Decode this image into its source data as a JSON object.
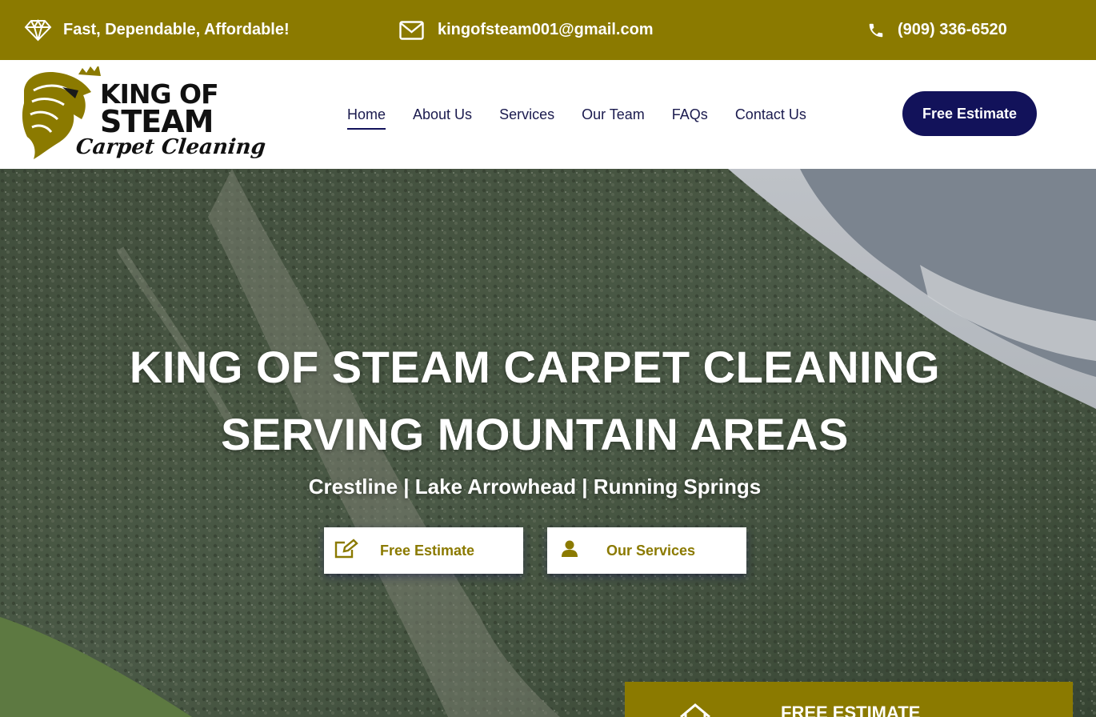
{
  "topbar": {
    "tagline": "Fast, Dependable, Affordable!",
    "email": "kingofsteam001@gmail.com",
    "phone": "(909) 336-6520",
    "background_color": "#8b7a00"
  },
  "header": {
    "logo": {
      "line1": "KING OF",
      "line2": "STEAM",
      "line3": "Carpet Cleaning"
    },
    "nav": [
      {
        "label": "Home",
        "active": true
      },
      {
        "label": "About Us"
      },
      {
        "label": "Services"
      },
      {
        "label": "Our Team"
      },
      {
        "label": "FAQs"
      },
      {
        "label": "Contact Us"
      }
    ],
    "cta_label": "Free Estimate",
    "cta_color": "#12125a"
  },
  "hero": {
    "title_line1": "KING OF STEAM CARPET CLEANING",
    "title_line2": "SERVING MOUNTAIN AREAS",
    "subtitle": "Crestline | Lake Arrowhead | Running Springs",
    "buttons": [
      {
        "label": "Free Estimate",
        "icon": "edit-icon"
      },
      {
        "label": "Our Services",
        "icon": "user-icon"
      }
    ]
  },
  "estimate_panel": {
    "title": "FREE ESTIMATE",
    "icon": "home-icon"
  }
}
